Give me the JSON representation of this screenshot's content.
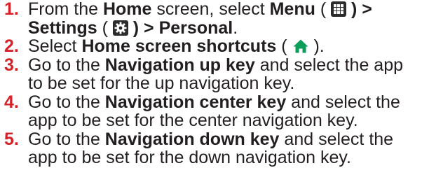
{
  "steps": [
    {
      "number": "1.",
      "parts": {
        "a": "From the ",
        "b": "Home",
        "c": " screen, select ",
        "d": "Menu",
        "e": " ( ",
        "f": " ) >",
        "g": "Settings",
        "h": " ( ",
        "i": " ) > Personal",
        "j": "."
      },
      "icons": [
        "menu-grid-icon",
        "settings-gear-icon"
      ]
    },
    {
      "number": "2.",
      "parts": {
        "a": "Select ",
        "b": "Home screen shortcuts",
        "c": " ( ",
        "d": " )."
      },
      "icons": [
        "home-icon"
      ],
      "colors": {
        "home_icon": "#0a9e5a"
      }
    },
    {
      "number": "3.",
      "parts": {
        "a": "Go to the ",
        "b": "Navigation up key",
        "c": " and select the app to be set for the up navigation key."
      }
    },
    {
      "number": "4.",
      "parts": {
        "a": "Go to the ",
        "b": "Navigation center key",
        "c": " and select the app to be set for the center navigation key."
      }
    },
    {
      "number": "5.",
      "parts": {
        "a": "Go to the ",
        "b": "Navigation down key",
        "c": " and select the app to be set for the down navigation key."
      }
    }
  ],
  "colors": {
    "step_number": "#d62128",
    "text": "#231f20",
    "icon_box": "#2b2b2b"
  }
}
